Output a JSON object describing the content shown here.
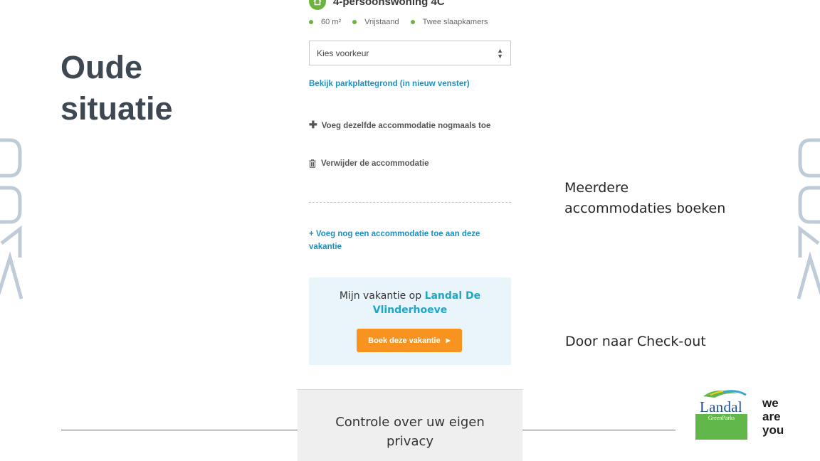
{
  "slide": {
    "title": "Oude\nsituatie",
    "annotations": {
      "multiple": "Meerdere\naccommodaties boeken",
      "checkout": "Door naar Check-out"
    }
  },
  "screenshot": {
    "accommodation_name": "4-persoonswoning 4C",
    "features": [
      "60 m²",
      "Vrijstaand",
      "Twee slaapkamers"
    ],
    "preference_select": {
      "value": "Kies voorkeur"
    },
    "map_link": "Bekijk parkplattegrond (in nieuw venster)",
    "add_same": "Voeg dezelfde accommodatie nogmaals toe",
    "remove": "Verwijder de accommodatie",
    "add_other": "+ Voeg nog een accommodatie toe aan deze vakantie",
    "vacation_box": {
      "prefix": "Mijn vakantie op ",
      "park": "Landal De Vlinderhoeve",
      "button": "Boek deze vakantie"
    },
    "privacy": "Controle over uw eigen\nprivacy"
  },
  "logo": {
    "brand": "Landal",
    "sub": "GreenParks",
    "tagline": "we\nare\nyou"
  },
  "colors": {
    "title": "#3d4852",
    "green": "#6cb33f",
    "link_blue": "#1f8fbf",
    "button_orange": "#f7931e",
    "box_bg": "#eaf4fb",
    "logo_blue": "#1f4f94"
  }
}
